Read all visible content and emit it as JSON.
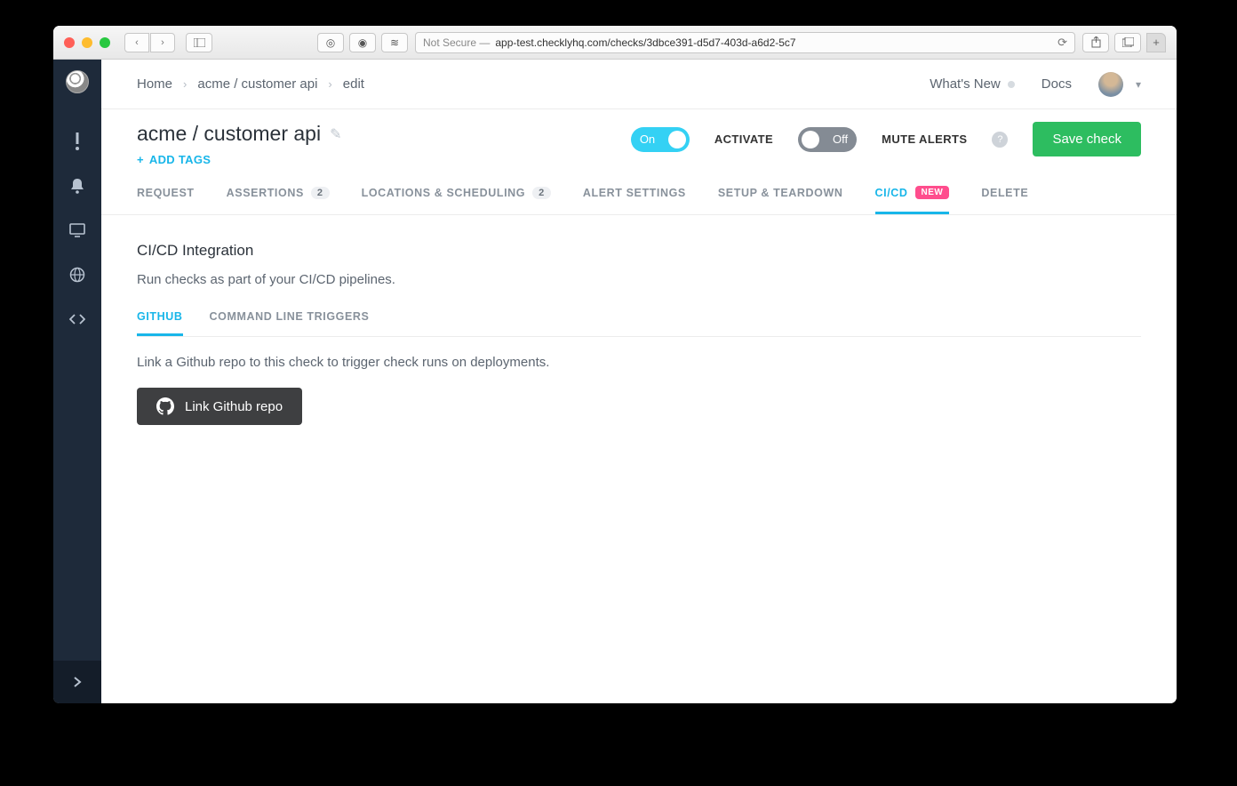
{
  "browser": {
    "not_secure": "Not Secure —",
    "url": "app-test.checklyhq.com/checks/3dbce391-d5d7-403d-a6d2-5c7"
  },
  "topbar": {
    "breadcrumb": [
      "Home",
      "acme / customer api",
      "edit"
    ],
    "whats_new": "What's New",
    "docs": "Docs"
  },
  "title": {
    "name": "acme / customer api",
    "add_tags": "ADD TAGS"
  },
  "controls": {
    "activate_on": "On",
    "activate_label": "ACTIVATE",
    "mute_off": "Off",
    "mute_label": "MUTE ALERTS",
    "save": "Save check"
  },
  "tabs": {
    "request": "REQUEST",
    "assertions": "ASSERTIONS",
    "assertions_count": "2",
    "locations": "LOCATIONS & SCHEDULING",
    "locations_count": "2",
    "alert": "ALERT SETTINGS",
    "setup": "SETUP & TEARDOWN",
    "cicd": "CI/CD",
    "cicd_badge": "NEW",
    "delete": "DELETE"
  },
  "content": {
    "section_title": "CI/CD Integration",
    "section_desc": "Run checks as part of your CI/CD pipelines.",
    "subtab_github": "GITHUB",
    "subtab_cli": "COMMAND LINE TRIGGERS",
    "link_desc": "Link a Github repo to this check to trigger check runs on deployments.",
    "github_btn": "Link Github repo"
  }
}
